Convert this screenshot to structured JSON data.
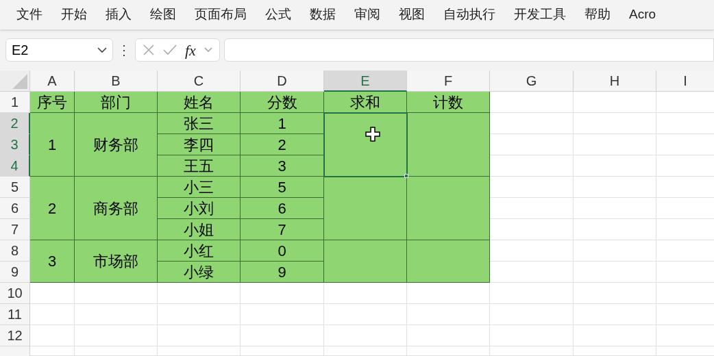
{
  "menu": [
    {
      "label": "文件"
    },
    {
      "label": "开始"
    },
    {
      "label": "插入"
    },
    {
      "label": "绘图"
    },
    {
      "label": "页面布局"
    },
    {
      "label": "公式"
    },
    {
      "label": "数据"
    },
    {
      "label": "审阅"
    },
    {
      "label": "视图"
    },
    {
      "label": "自动执行"
    },
    {
      "label": "开发工具"
    },
    {
      "label": "帮助"
    },
    {
      "label": "Acro"
    }
  ],
  "formula_bar": {
    "name_box": "E2",
    "function_label": "fx",
    "value_separator": "⋮"
  },
  "column_headers": [
    {
      "label": "A",
      "selected": false
    },
    {
      "label": "B",
      "selected": false
    },
    {
      "label": "C",
      "selected": false
    },
    {
      "label": "D",
      "selected": false
    },
    {
      "label": "E",
      "selected": true
    },
    {
      "label": "F",
      "selected": false
    },
    {
      "label": "G",
      "selected": false
    },
    {
      "label": "H",
      "selected": false
    },
    {
      "label": "I",
      "selected": false
    }
  ],
  "row_headers": [
    {
      "label": "1",
      "selected": false
    },
    {
      "label": "2",
      "selected": true
    },
    {
      "label": "3",
      "selected": true
    },
    {
      "label": "4",
      "selected": true
    },
    {
      "label": "5",
      "selected": false
    },
    {
      "label": "6",
      "selected": false
    },
    {
      "label": "7",
      "selected": false
    },
    {
      "label": "8",
      "selected": false
    },
    {
      "label": "9",
      "selected": false
    },
    {
      "label": "10",
      "selected": false
    },
    {
      "label": "11",
      "selected": false
    },
    {
      "label": "12",
      "selected": false
    }
  ],
  "table": {
    "header": [
      "序号",
      "部门",
      "姓名",
      "分数",
      "求和",
      "计数"
    ],
    "groups": [
      {
        "index": "1",
        "department": "财务部",
        "selected": true,
        "members": [
          {
            "name": "张三",
            "score": "1"
          },
          {
            "name": "李四",
            "score": "2"
          },
          {
            "name": "王五",
            "score": "3"
          }
        ]
      },
      {
        "index": "2",
        "department": "商务部",
        "selected": false,
        "members": [
          {
            "name": "小三",
            "score": "5"
          },
          {
            "name": "小刘",
            "score": "6"
          },
          {
            "name": "小姐",
            "score": "7"
          }
        ]
      },
      {
        "index": "3",
        "department": "市场部",
        "selected": false,
        "members": [
          {
            "name": "小红",
            "score": "0"
          },
          {
            "name": "小绿",
            "score": "9"
          }
        ]
      }
    ]
  }
}
